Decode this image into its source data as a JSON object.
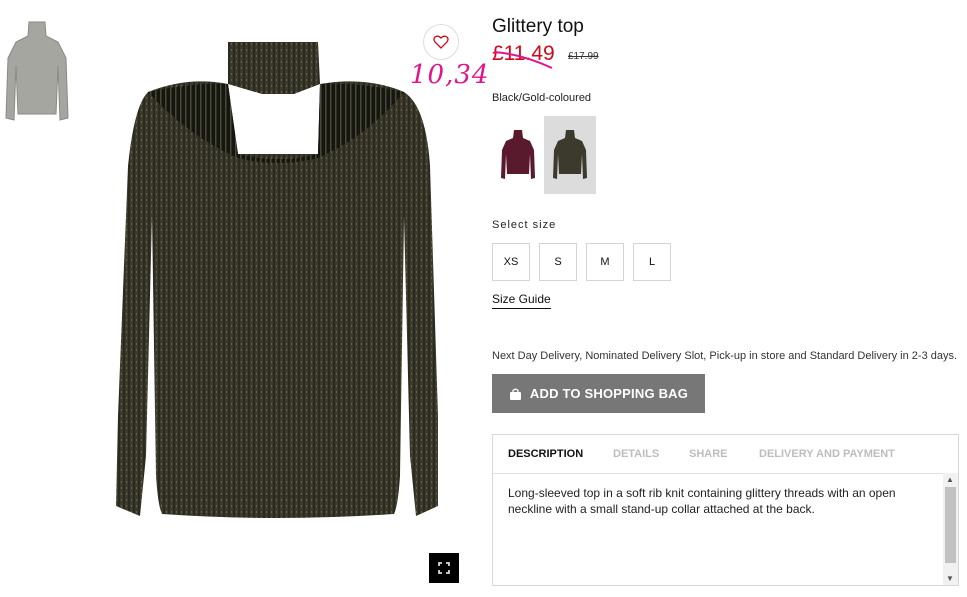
{
  "product": {
    "title": "Glittery top",
    "price": "£11.49",
    "old_price": "£17.99",
    "handwritten_price": "10,34",
    "color_name": "Black/Gold-coloured"
  },
  "size": {
    "label": "Select size",
    "options": [
      "XS",
      "S",
      "M",
      "L"
    ],
    "guide": "Size Guide"
  },
  "delivery_text": "Next Day Delivery, Nominated Delivery Slot, Pick-up in store and Standard Delivery in 2-3 days.",
  "add_to_bag": "ADD TO SHOPPING BAG",
  "tabs": [
    "DESCRIPTION",
    "DETAILS",
    "SHARE",
    "DELIVERY AND PAYMENT"
  ],
  "description": "Long-sleeved top in a soft rib knit containing glittery threads with an open neckline with a small stand-up collar attached at the back.",
  "colors": {
    "sweater": "#3b3a2c",
    "price_red": "#cc0a1a",
    "handwriting": "#e0148c",
    "button_grey": "#777777",
    "burgundy": "#5a1a2e"
  },
  "icons": {
    "wishlist": "heart-icon",
    "fullscreen": "expand-icon",
    "bag": "shopping-bag-icon"
  }
}
